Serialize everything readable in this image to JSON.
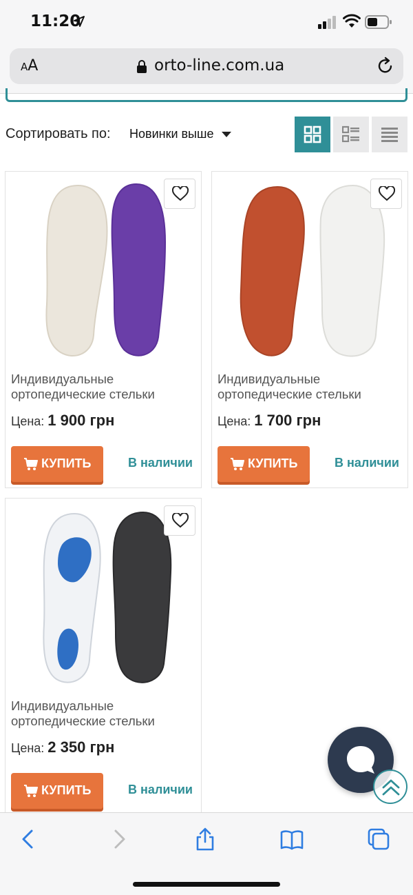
{
  "status": {
    "time": "11:20"
  },
  "browser": {
    "text_size_small": "A",
    "text_size_large": "A",
    "url": "orto-line.com.ua"
  },
  "sort": {
    "label": "Сортировать по:",
    "selected": "Новинки выше"
  },
  "view_modes": [
    "grid",
    "tiles",
    "list"
  ],
  "colors": {
    "accent": "#2f8f97",
    "buy": "#e7743c",
    "chat": "#2d3a4f"
  },
  "products": [
    {
      "title": "Индивидуальные ортопедические стельки",
      "price_label": "Цена:",
      "price": "1 900 грн",
      "buy_label": "КУПИТЬ",
      "stock": "В наличии"
    },
    {
      "title": "Индивидуальные ортопедические стельки",
      "price_label": "Цена:",
      "price": "1 700 грн",
      "buy_label": "КУПИТЬ",
      "stock": "В наличии"
    },
    {
      "title": "Индивидуальные ортопедические стельки",
      "price_label": "Цена:",
      "price": "2 350 грн",
      "buy_label": "КУПИТЬ",
      "stock": "В наличии"
    }
  ],
  "icons": [
    "location-arrow-icon",
    "signal-icon",
    "wifi-icon",
    "battery-icon",
    "lock-icon",
    "reload-icon",
    "heart-icon",
    "cart-icon",
    "chat-icon",
    "chevrons-up-icon",
    "back-icon",
    "forward-icon",
    "share-icon",
    "bookmarks-icon",
    "tabs-icon"
  ]
}
